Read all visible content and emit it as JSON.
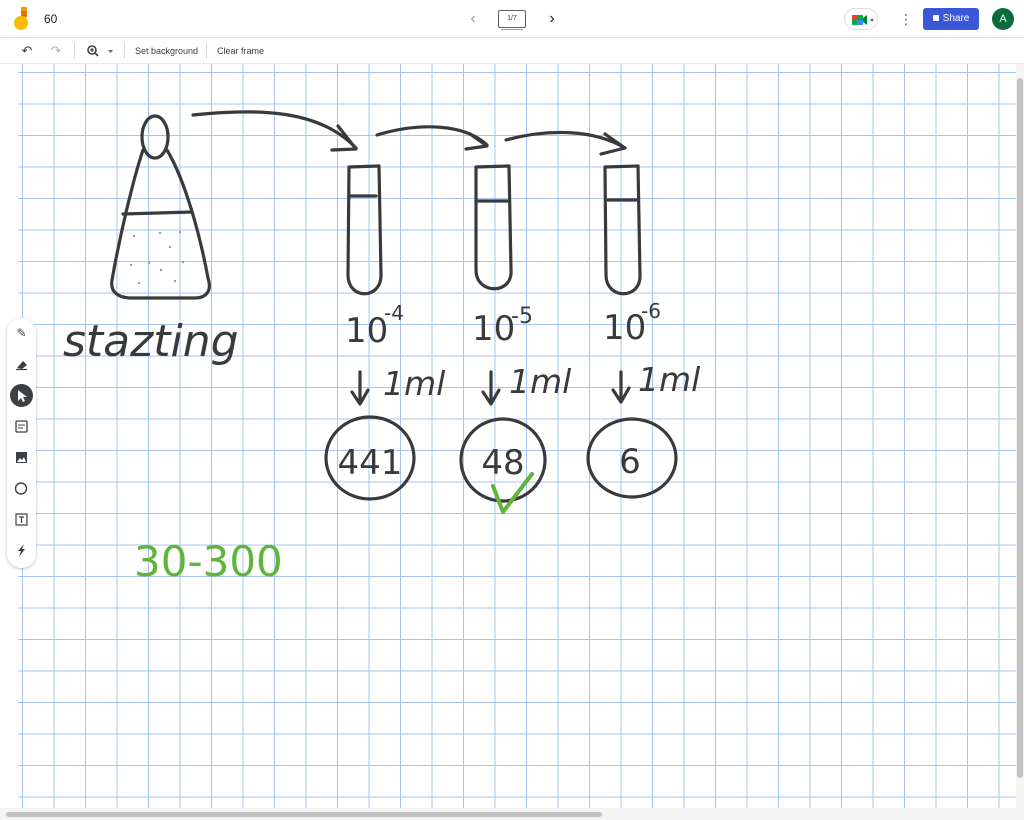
{
  "app": {
    "title": "60",
    "colors": {
      "accent": "#3a57d8",
      "avatar_bg": "#0b6b3a",
      "grid": "#a9c4f2",
      "ink": "#3a3a3a",
      "green_ink": "#5fb43a"
    }
  },
  "topbar": {
    "prev_icon": "chevron-left-icon",
    "frame_indicator": "1/7",
    "next_icon": "chevron-right-icon",
    "meet_icon": "meet-icon",
    "more_icon": "more-vert-icon",
    "share_label": "Share",
    "avatar_initial": "A"
  },
  "toolbar": {
    "undo_icon": "undo-icon",
    "redo_icon": "redo-icon",
    "zoom_icon": "zoom-icon",
    "set_background_label": "Set background",
    "clear_frame_label": "Clear frame"
  },
  "tools": [
    {
      "name": "pen-tool",
      "icon": "pen-icon",
      "active": false
    },
    {
      "name": "eraser-tool",
      "icon": "eraser-icon",
      "active": false
    },
    {
      "name": "select-tool",
      "icon": "cursor-icon",
      "active": true
    },
    {
      "name": "sticky-note-tool",
      "icon": "sticky-note-icon",
      "active": false
    },
    {
      "name": "image-tool",
      "icon": "image-icon",
      "active": false
    },
    {
      "name": "shape-tool",
      "icon": "circle-icon",
      "active": false
    },
    {
      "name": "text-box-tool",
      "icon": "text-box-icon",
      "active": false
    },
    {
      "name": "laser-tool",
      "icon": "laser-icon",
      "active": false
    }
  ],
  "drawing": {
    "starting_label": "stazting",
    "dilutions": [
      {
        "base": "10",
        "exponent": "-4",
        "volume": "1ml",
        "count": "441"
      },
      {
        "base": "10",
        "exponent": "-5",
        "volume": "1ml",
        "count": "48"
      },
      {
        "base": "10",
        "exponent": "-6",
        "volume": "1ml",
        "count": "6"
      }
    ],
    "range_label": "30-300"
  }
}
